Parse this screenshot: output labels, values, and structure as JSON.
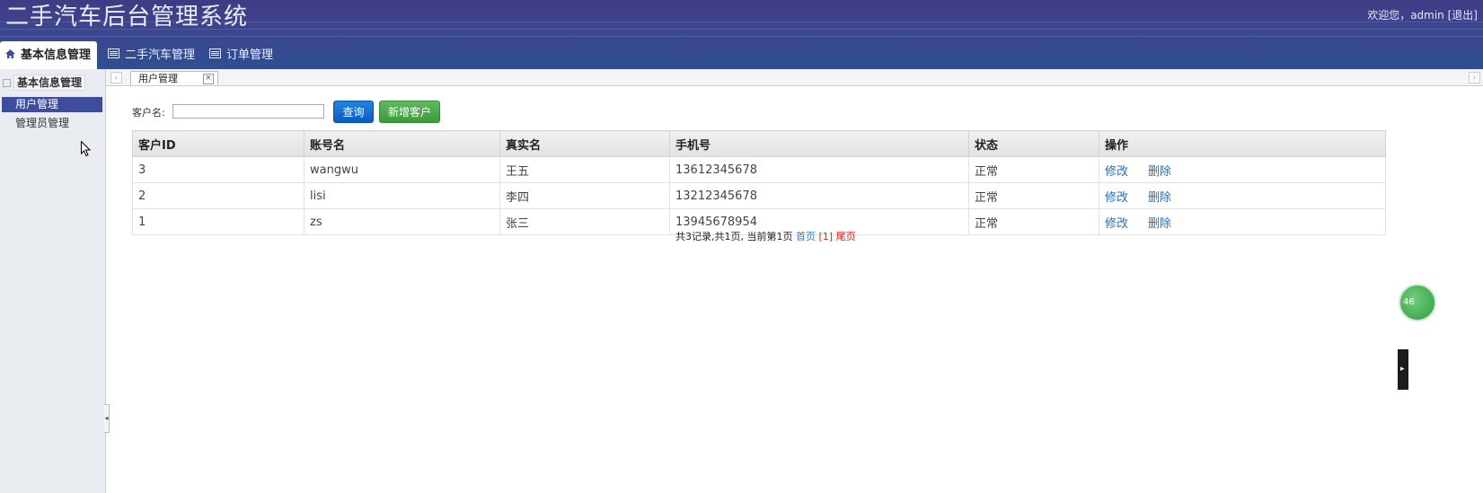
{
  "header": {
    "title": "二手汽车后台管理系统",
    "welcome": "欢迎您，admin",
    "logout": "[退出]"
  },
  "nav": {
    "tabs": [
      {
        "label": "基本信息管理",
        "active": true,
        "icon": "home-icon"
      },
      {
        "label": "二手汽车管理",
        "active": false,
        "icon": "list-icon"
      },
      {
        "label": "订单管理",
        "active": false,
        "icon": "list-icon"
      }
    ]
  },
  "sidebar": {
    "title": "基本信息管理",
    "items": [
      {
        "label": "用户管理",
        "active": true
      },
      {
        "label": "管理员管理",
        "active": false
      }
    ]
  },
  "tabstrip": {
    "open_tab": "用户管理",
    "close": "×",
    "scroll_left": "‹",
    "scroll_right": "›"
  },
  "search": {
    "label": "客户名:",
    "value": "",
    "query_button": "查询",
    "add_button": "新增客户"
  },
  "table": {
    "columns": [
      "客户ID",
      "账号名",
      "真实名",
      "手机号",
      "状态",
      "操作"
    ],
    "rows": [
      {
        "id": "3",
        "account": "wangwu",
        "realname": "王五",
        "phone": "13612345678",
        "status": "正常"
      },
      {
        "id": "2",
        "account": "lisi",
        "realname": "李四",
        "phone": "13212345678",
        "status": "正常"
      },
      {
        "id": "1",
        "account": "zs",
        "realname": "张三",
        "phone": "13945678954",
        "status": "正常"
      }
    ],
    "edit_label": "修改",
    "delete_label": "删除"
  },
  "pager": {
    "summary": "共3记录,共1页, 当前第1页",
    "first": "首页",
    "current": "[1]",
    "last": "尾页"
  },
  "widgets": {
    "float_ball": "46",
    "side_arrow": "▸",
    "collapse": "◂"
  },
  "colors": {
    "header_top": "#3f3b83",
    "header_bottom": "#2f4f8f",
    "sidebar_active": "#3e4c9e",
    "query_button": "#0a5bc4",
    "add_button": "#3e983e",
    "link": "#2a6fb8",
    "pager_current": "#dd2222"
  }
}
